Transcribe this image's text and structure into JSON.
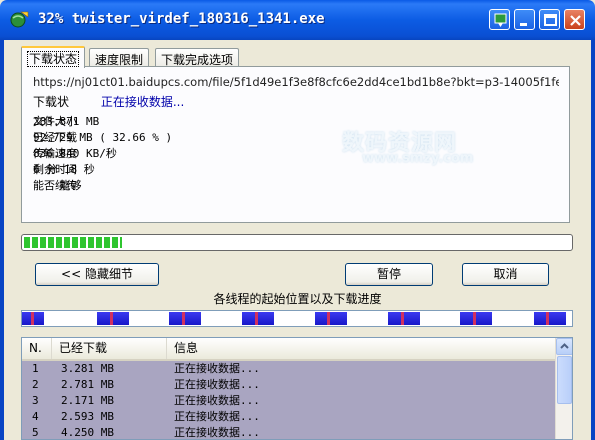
{
  "window": {
    "title": "32% twister_virdef_180316_1341.exe",
    "icon": "app-globe-icon"
  },
  "tabs": [
    {
      "label": "下载状态",
      "active": true
    },
    {
      "label": "速度限制",
      "active": false
    },
    {
      "label": "下载完成选项",
      "active": false
    }
  ],
  "status": {
    "url": "https://nj01ct01.baidupcs.com/file/5f1d49e1f3e8f8cfc6e2dd4ce1bd1b8e?bkt=p3-14005f1fef93445",
    "label": "下载状",
    "value": "正在接收数据..."
  },
  "info": [
    {
      "key": "文件大小",
      "value": "283.871 MB"
    },
    {
      "key": "已经下载",
      "value": "92.729 MB ( 32.66 % )"
    },
    {
      "key": "传输速度",
      "value": "836.840 KB/秒"
    },
    {
      "key": "剩余时间",
      "value": "6 分 18 秒"
    },
    {
      "key": "能否续传",
      "value": "    能够"
    }
  ],
  "watermark": {
    "text": "数码资源网",
    "url": "www.smzy.com"
  },
  "progress": {
    "percent": 32.66
  },
  "buttons": {
    "hide_details": "<< 隐藏细节",
    "pause": "暂停",
    "cancel": "取消"
  },
  "threads_caption": "各线程的起始位置以及下载进度",
  "thread_segments": [
    0,
    0.136,
    0.268,
    0.4,
    0.532,
    0.665,
    0.797,
    0.93
  ],
  "list": {
    "columns": [
      "N.",
      "已经下载",
      "信息"
    ],
    "rows": [
      {
        "n": "1",
        "downloaded": "3.281 MB",
        "info": "正在接收数据..."
      },
      {
        "n": "2",
        "downloaded": "2.781 MB",
        "info": "正在接收数据..."
      },
      {
        "n": "3",
        "downloaded": "2.171 MB",
        "info": "正在接收数据..."
      },
      {
        "n": "4",
        "downloaded": "2.593 MB",
        "info": "正在接收数据..."
      },
      {
        "n": "5",
        "downloaded": "4.250 MB",
        "info": "正在接收数据..."
      },
      {
        "n": "6",
        "downloaded": "3.453 MB",
        "info": "正在接收数据..."
      }
    ]
  },
  "colors": {
    "titlebar": "#0a5ae6",
    "progress_green": "#2fc52f",
    "segment_blue": "#2020d8",
    "row_bg": "#a9a5c1"
  }
}
